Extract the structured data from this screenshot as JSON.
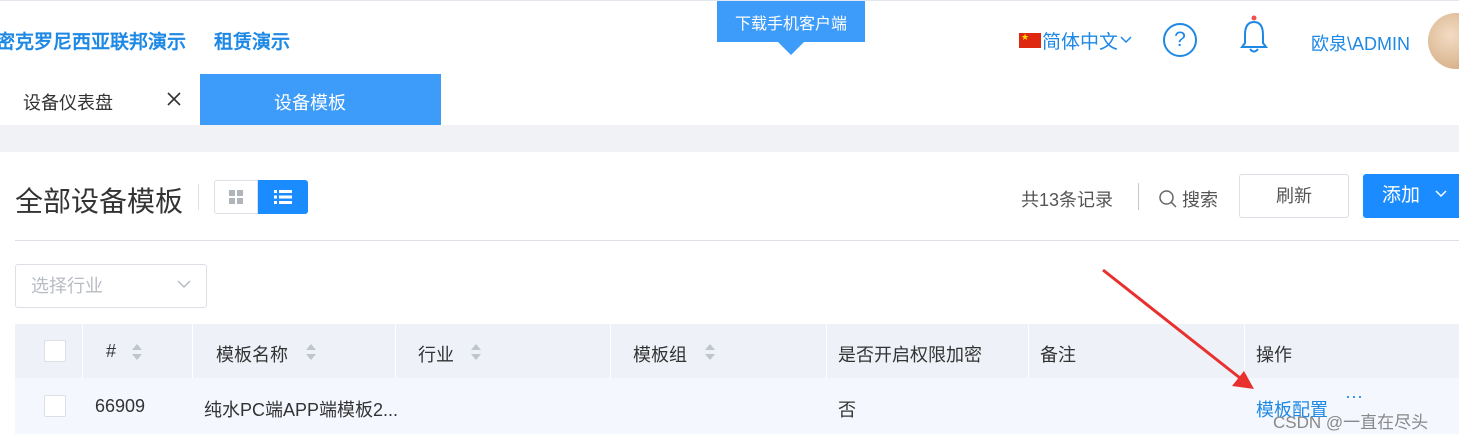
{
  "header": {
    "brand_links": [
      "密克罗尼西亚联邦演示",
      "租赁演示"
    ],
    "download_tab": "下载手机客户端",
    "language": "简体中文",
    "help_icon": "question-circle-icon",
    "bell_icon": "bell-icon",
    "user": "欧泉\\ADMIN"
  },
  "tabs": [
    {
      "label": "设备仪表盘",
      "active": false
    },
    {
      "label": "设备模板",
      "active": true
    }
  ],
  "page": {
    "title": "全部设备模板",
    "record_count": "共13条记录",
    "search_label": "搜索",
    "refresh_label": "刷新",
    "add_label": "添加"
  },
  "filter": {
    "industry_placeholder": "选择行业"
  },
  "table": {
    "columns": [
      "#",
      "模板名称",
      "行业",
      "模板组",
      "是否开启权限加密",
      "备注",
      "操作"
    ],
    "rows": [
      {
        "id": "66909",
        "name": "纯水PC端APP端模板2...",
        "industry": "",
        "group": "",
        "encrypted": "否",
        "note": "",
        "action": "模板配置",
        "more": "···"
      }
    ]
  },
  "annotation": {
    "arrow_color": "#e8312f"
  },
  "watermark": "CSDN @一直在尽头",
  "colors": {
    "primary": "#1a8cff",
    "link": "#1e88e5",
    "active_tab": "#3d9bfa"
  }
}
